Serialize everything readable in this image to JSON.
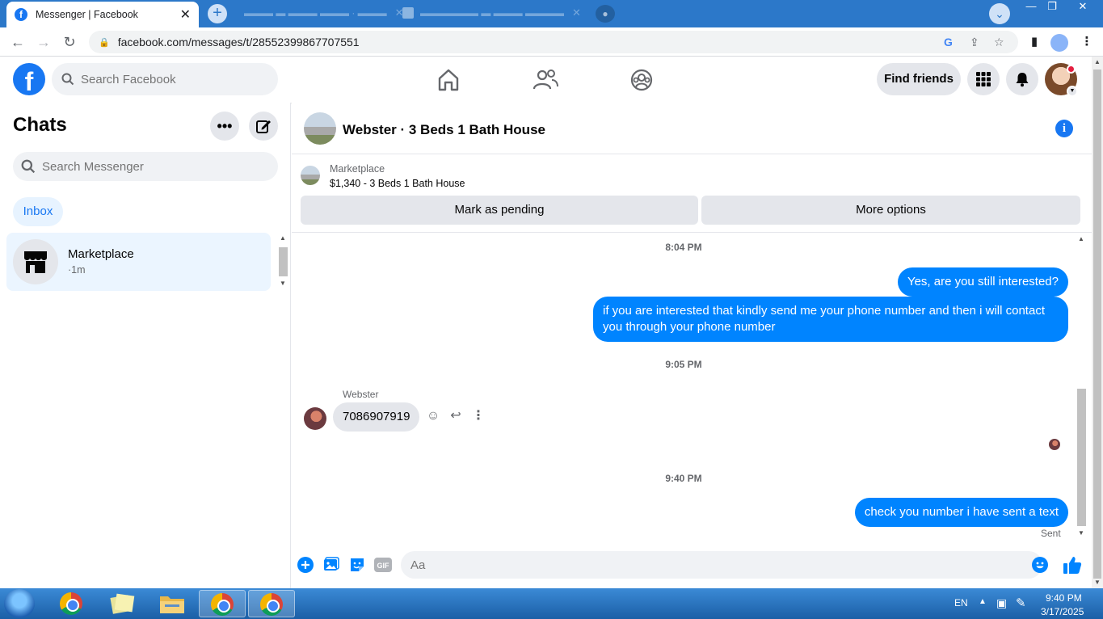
{
  "browser": {
    "active_tab_title": "Messenger | Facebook",
    "url": "facebook.com/messages/t/28552399867707551"
  },
  "facebook": {
    "search_placeholder": "Search Facebook",
    "find_friends": "Find friends"
  },
  "chats": {
    "title": "Chats",
    "search_placeholder": "Search Messenger",
    "inbox_label": "Inbox",
    "items": [
      {
        "name": "Marketplace",
        "time": "·1m"
      }
    ]
  },
  "conversation": {
    "title": "Webster · 3 Beds 1 Bath House",
    "marketplace_label": "Marketplace",
    "listing_summary": "$1,340 - 3 Beds 1 Bath House",
    "mark_pending": "Mark as pending",
    "more_options": "More options",
    "messages": [
      {
        "type": "timestamp",
        "text": "8:04 PM"
      },
      {
        "type": "out",
        "text": "Yes, are you still interested?"
      },
      {
        "type": "out",
        "text": "if you are interested that kindly send me your phone number and then i will contact you through your phone number"
      },
      {
        "type": "timestamp",
        "text": "9:05 PM"
      },
      {
        "type": "in",
        "sender": "Webster",
        "text": "7086907919"
      },
      {
        "type": "timestamp",
        "text": "9:40 PM"
      },
      {
        "type": "out",
        "text": "check you number i have sent a text"
      }
    ],
    "sent_status": "Sent",
    "composer_placeholder": "Aa"
  },
  "taskbar": {
    "language": "EN",
    "time": "9:40 PM",
    "date": "3/17/2025"
  },
  "colors": {
    "fb_blue": "#1877f2",
    "messenger_blue": "#0084ff",
    "taskbar_blue": "#1b5fa6"
  }
}
